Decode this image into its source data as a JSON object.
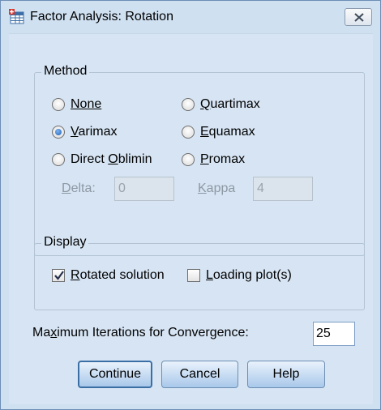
{
  "window": {
    "title": "Factor Analysis: Rotation"
  },
  "method": {
    "legend": "Method",
    "options": {
      "none": "None",
      "varimax": "Varimax",
      "direct_oblimin": "Direct Oblimin",
      "quartimax": "Quartimax",
      "equamax": "Equamax",
      "promax": "Promax"
    },
    "selected": "Varimax",
    "delta_label": "Delta:",
    "delta_value": "0",
    "kappa_label": "Kappa",
    "kappa_value": "4"
  },
  "display": {
    "legend": "Display",
    "rotated_solution_label": "Rotated solution",
    "rotated_solution_checked": true,
    "loading_plots_label": "Loading plot(s)",
    "loading_plots_checked": false
  },
  "iterations": {
    "label": "Maximum Iterations for Convergence:",
    "value": "25"
  },
  "buttons": {
    "continue": "Continue",
    "cancel": "Cancel",
    "help": "Help"
  },
  "colors": {
    "client_bg": "#d6e4f3",
    "button_top": "#e9f2fc",
    "button_bottom": "#a9c8ea"
  },
  "icons": {
    "app": "spss-table-icon",
    "close": "close-icon"
  }
}
